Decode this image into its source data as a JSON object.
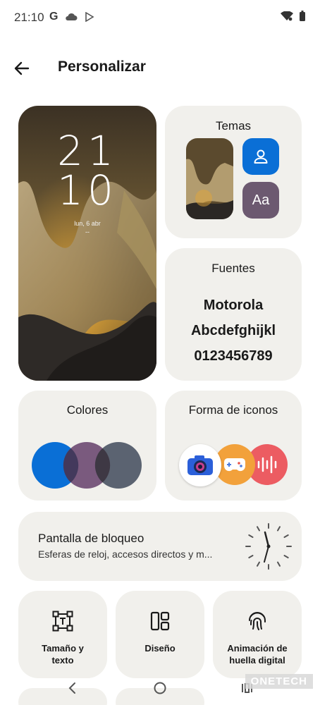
{
  "status": {
    "time": "21:10"
  },
  "header": {
    "title": "Personalizar"
  },
  "wallpaper": {
    "hour_top": "21",
    "hour_bottom": "10",
    "date": "lun, 6 abr",
    "dash": "--"
  },
  "temas": {
    "title": "Temas",
    "font_badge": "Aa"
  },
  "fuentes": {
    "title": "Fuentes",
    "samples": [
      "Motorola",
      "Abcdefghijkl",
      "0123456789"
    ]
  },
  "colores": {
    "title": "Colores",
    "swatches": [
      "#0a6fd6",
      "#7a5a7e",
      "#5b6371"
    ]
  },
  "iconos": {
    "title": "Forma de iconos"
  },
  "bloqueo": {
    "title": "Pantalla de bloqueo",
    "subtitle": "Esferas de reloj, accesos directos y m..."
  },
  "tiles": [
    {
      "label_line1": "Tamaño y",
      "label_line2": "texto",
      "icon": "text-size-icon"
    },
    {
      "label_line1": "Diseño",
      "label_line2": "",
      "icon": "layout-icon"
    },
    {
      "label_line1": "Animación de",
      "label_line2": "huella digital",
      "icon": "fingerprint-icon"
    }
  ],
  "watermark": "ONETECH"
}
